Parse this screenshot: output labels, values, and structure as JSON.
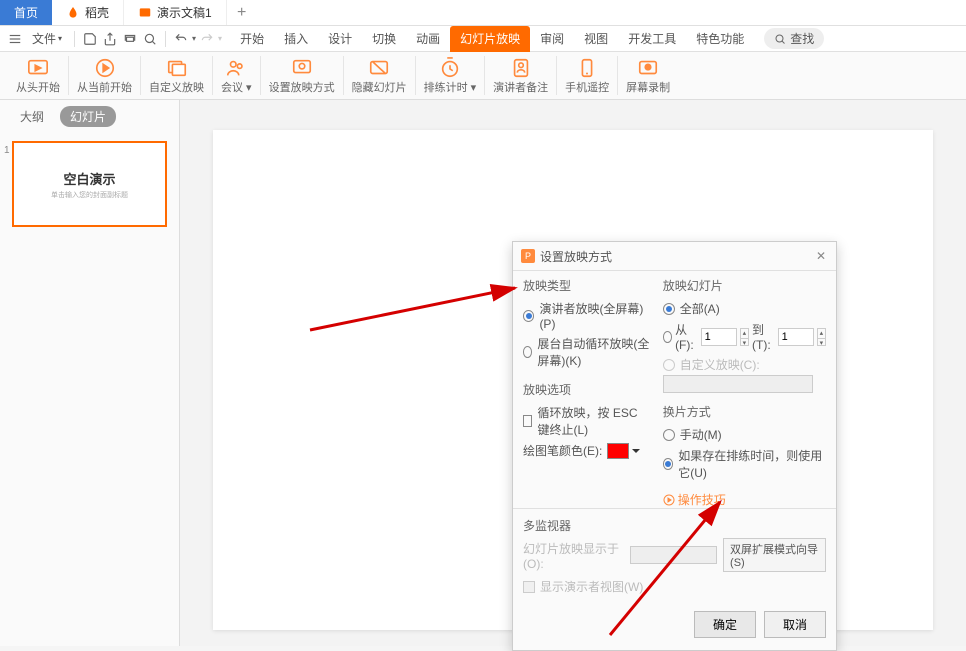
{
  "tabs": {
    "home": "首页",
    "dao": "稻壳",
    "doc": "演示文稿1"
  },
  "menubar": {
    "file": "文件",
    "search": "查找"
  },
  "ribbon_tabs": [
    "开始",
    "插入",
    "设计",
    "切换",
    "动画",
    "幻灯片放映",
    "审阅",
    "视图",
    "开发工具",
    "特色功能"
  ],
  "ribbon": {
    "from_start": "从头开始",
    "from_current": "从当前开始",
    "custom": "自定义放映",
    "meeting": "会议",
    "settings": "设置放映方式",
    "hide": "隐藏幻灯片",
    "rehearse": "排练计时",
    "notes": "演讲者备注",
    "remote": "手机遥控",
    "record": "屏幕录制"
  },
  "sidebar": {
    "outline": "大纲",
    "slides": "幻灯片",
    "slide_num": "1",
    "slide_title": "空白演示",
    "slide_sub": "单击输入您的封面副标题"
  },
  "dialog": {
    "title": "设置放映方式",
    "type_label": "放映类型",
    "type_speaker": "演讲者放映(全屏幕)(P)",
    "type_kiosk": "展台自动循环放映(全屏幕)(K)",
    "options_label": "放映选项",
    "loop": "循环放映，按 ESC 键终止(L)",
    "pen_color": "绘图笔颜色(E):",
    "monitor_label": "多监视器",
    "monitor_on": "幻灯片放映显示于(O):",
    "presenter_view": "显示演示者视图(W)",
    "extend": "双屏扩展模式向导(S)",
    "slides_label": "放映幻灯片",
    "all": "全部(A)",
    "from": "从(F):",
    "to": "到(T):",
    "from_val": "1",
    "to_val": "1",
    "custom_show": "自定义放映(C):",
    "advance_label": "换片方式",
    "manual": "手动(M)",
    "timings": "如果存在排练时间，则使用它(U)",
    "tips": "操作技巧",
    "ok": "确定",
    "cancel": "取消"
  }
}
